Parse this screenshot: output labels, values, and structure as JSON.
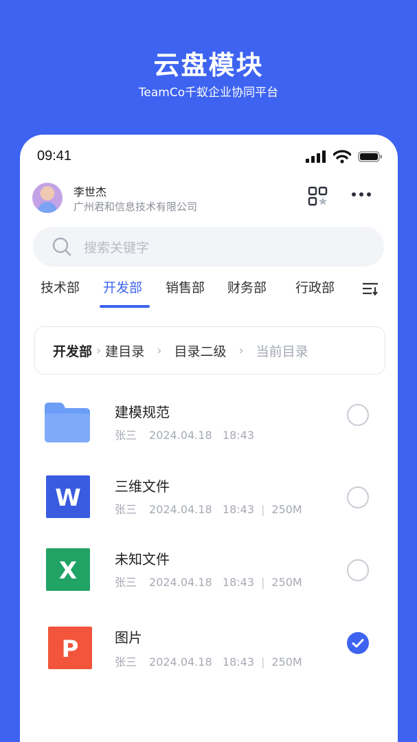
{
  "hero": {
    "title": "云盘模块",
    "subtitle": "TeamCo千蚁企业协同平台"
  },
  "status_bar": {
    "time": "09:41",
    "icons": [
      "signal-icon",
      "wifi-icon",
      "battery-icon"
    ]
  },
  "user": {
    "name": "李世杰",
    "organization": "广州君和信息技术有限公司"
  },
  "search": {
    "placeholder": "搜索关键字"
  },
  "tabs": [
    {
      "label": "技术部",
      "active": false
    },
    {
      "label": "开发部",
      "active": true
    },
    {
      "label": "销售部",
      "active": false
    },
    {
      "label": "财务部",
      "active": false
    },
    {
      "label": "行政部",
      "active": false
    }
  ],
  "breadcrumb": {
    "root": "开发部",
    "items": [
      "建目录",
      "目录二级",
      "当前目录"
    ]
  },
  "files": [
    {
      "name": "建模规范",
      "type": "folder-icon",
      "owner": "张三",
      "date": "2024.04.18",
      "time": "18:43",
      "size": "",
      "checked": false
    },
    {
      "name": "三维文件",
      "type": "word-icon",
      "owner": "张三",
      "date": "2024.04.18",
      "time": "18:43",
      "size": "250M",
      "checked": false
    },
    {
      "name": "未知文件",
      "type": "excel-icon",
      "owner": "张三",
      "date": "2024.04.18",
      "time": "18:43",
      "size": "250M",
      "checked": false
    },
    {
      "name": "图片",
      "type": "ppt-icon",
      "owner": "张三",
      "date": "2024.04.18",
      "time": "18:43",
      "size": "250M",
      "checked": true
    }
  ],
  "colors": {
    "accent": "#3D63F0",
    "word": "#3A5BE0",
    "excel": "#21A366",
    "ppt": "#F2553B",
    "folder": "#6C9DF7"
  }
}
